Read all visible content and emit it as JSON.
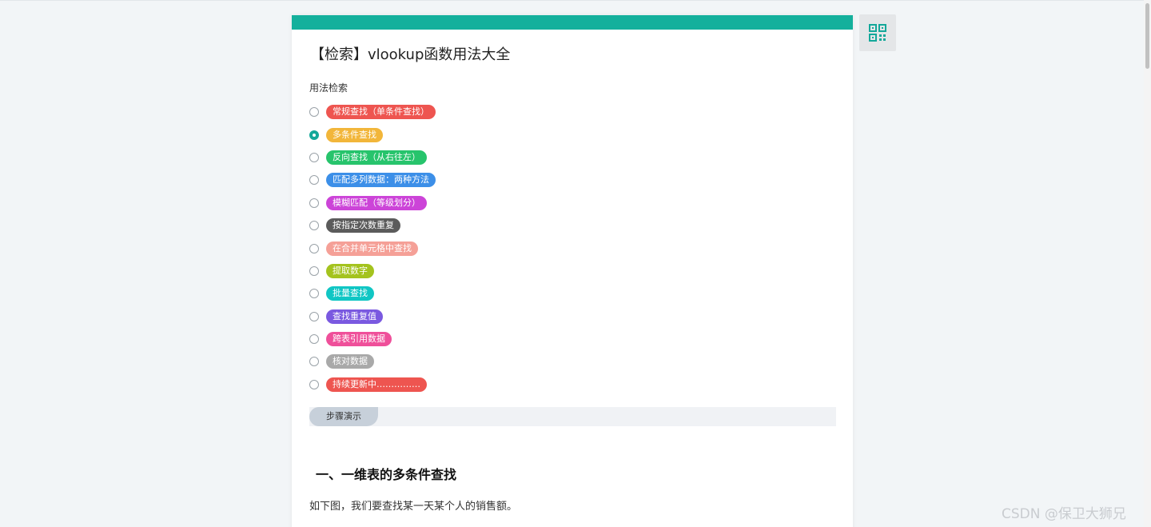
{
  "title": "【检索】vlookup函数用法大全",
  "section_label": "用法检索",
  "options": [
    {
      "label": "常规查找（单条件查找）",
      "color": "#ee5550",
      "checked": false
    },
    {
      "label": "多条件查找",
      "color": "#f2b63a",
      "checked": true
    },
    {
      "label": "反向查找（从右往左）",
      "color": "#27c46c",
      "checked": false
    },
    {
      "label": "匹配多列数据：两种方法",
      "color": "#3c8fe8",
      "checked": false
    },
    {
      "label": "模糊匹配（等级划分）",
      "color": "#cc44d8",
      "checked": false
    },
    {
      "label": "按指定次数重复",
      "color": "#5b5b5b",
      "checked": false
    },
    {
      "label": "在合并单元格中查找",
      "color": "#f5a097",
      "checked": false
    },
    {
      "label": "提取数字",
      "color": "#a4c31e",
      "checked": false
    },
    {
      "label": "批量查找",
      "color": "#10c6c4",
      "checked": false
    },
    {
      "label": "查找重复值",
      "color": "#7a59e0",
      "checked": false
    },
    {
      "label": "跨表引用数据",
      "color": "#ef4f9a",
      "checked": false
    },
    {
      "label": "核对数据",
      "color": "#a9a9a9",
      "checked": false
    },
    {
      "label": "持续更新中……………",
      "color": "#ee5550",
      "checked": false
    }
  ],
  "step_tab": "步骤演示",
  "heading": "一、一维表的多条件查找",
  "paragraph": "如下图，我们要查找某一天某个人的销售额。",
  "watermark": "CSDN @保卫大狮兄",
  "colors": {
    "accent": "#14b09c"
  },
  "icons": {
    "qr": "qr-code-icon"
  }
}
